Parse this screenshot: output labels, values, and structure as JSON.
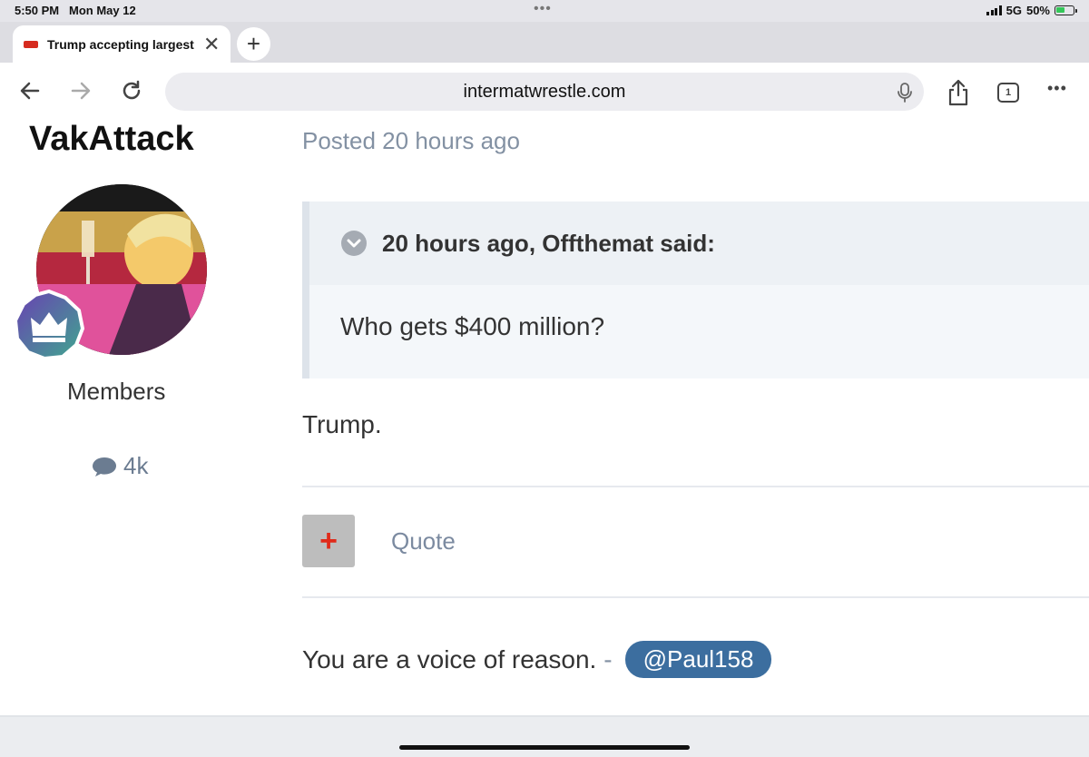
{
  "status_bar": {
    "time": "5:50 PM",
    "date": "Mon May 12",
    "network": "5G",
    "battery": "50%"
  },
  "tab": {
    "title": "Trump accepting largest"
  },
  "url_bar": {
    "url": "intermatwrestle.com"
  },
  "toolbar": {
    "tab_count": "1"
  },
  "author": {
    "name": "VakAttack",
    "group": "Members",
    "post_count": "4k"
  },
  "post": {
    "posted": "Posted 20 hours ago",
    "quote": {
      "citation": "20 hours ago, Offthemat said:",
      "text": "Who gets $400 million?"
    },
    "reply": "Trump.",
    "quote_button": "Quote",
    "signature": {
      "text": "You are a voice of reason.",
      "separator": "-",
      "mention": "@Paul158"
    }
  },
  "colors": {
    "mention_bg": "#3c6e9f",
    "quote_bar": "#dde3ea",
    "plus_icon": "#e02a1a"
  }
}
